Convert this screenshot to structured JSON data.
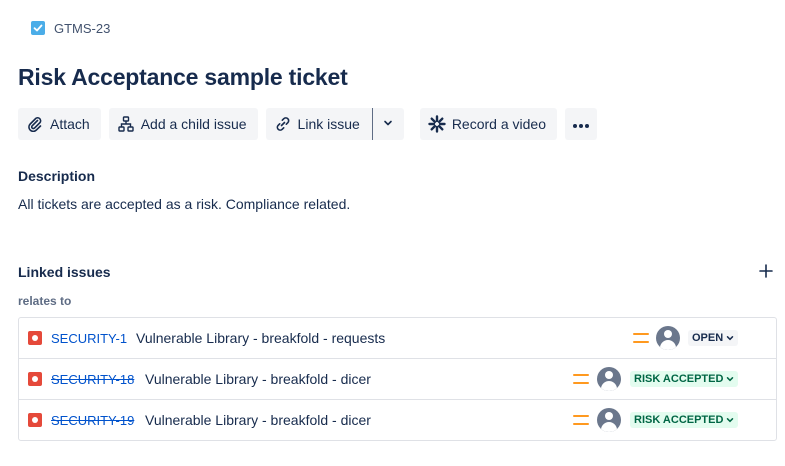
{
  "breadcrumb": {
    "issue_key": "GTMS-23"
  },
  "issue": {
    "title": "Risk Acceptance sample ticket"
  },
  "toolbar": {
    "attach": "Attach",
    "add_child": "Add a child issue",
    "link_issue": "Link issue",
    "record_video": "Record a video"
  },
  "description": {
    "heading": "Description",
    "text": "All tickets are accepted as a risk. Compliance related."
  },
  "linked_issues": {
    "heading": "Linked issues",
    "relation": "relates to",
    "items": [
      {
        "key": "SECURITY-1",
        "summary": "Vulnerable Library - breakfold - requests",
        "status": "OPEN",
        "resolved": false
      },
      {
        "key": "SECURITY-18",
        "summary": "Vulnerable Library - breakfold - dicer",
        "status": "RISK ACCEPTED",
        "resolved": true
      },
      {
        "key": "SECURITY-19",
        "summary": "Vulnerable Library - breakfold - dicer",
        "status": "RISK ACCEPTED",
        "resolved": true
      }
    ]
  },
  "colors": {
    "link": "#0052cc",
    "bug_icon": "#e5493a",
    "priority_medium": "#ff991f",
    "status_accepted_bg": "#e3fcef",
    "status_accepted_text": "#006644",
    "task_icon": "#4bade8"
  },
  "icons": {
    "task_type": "checkbox-icon",
    "attach": "paperclip-icon",
    "child": "hierarchy-icon",
    "link": "link-icon",
    "dropdown": "chevron-down-icon",
    "record": "loom-icon",
    "more": "more-icon",
    "add": "plus-icon",
    "issue_type": "bug-icon",
    "priority": "priority-medium-icon",
    "assignee": "avatar-icon"
  }
}
